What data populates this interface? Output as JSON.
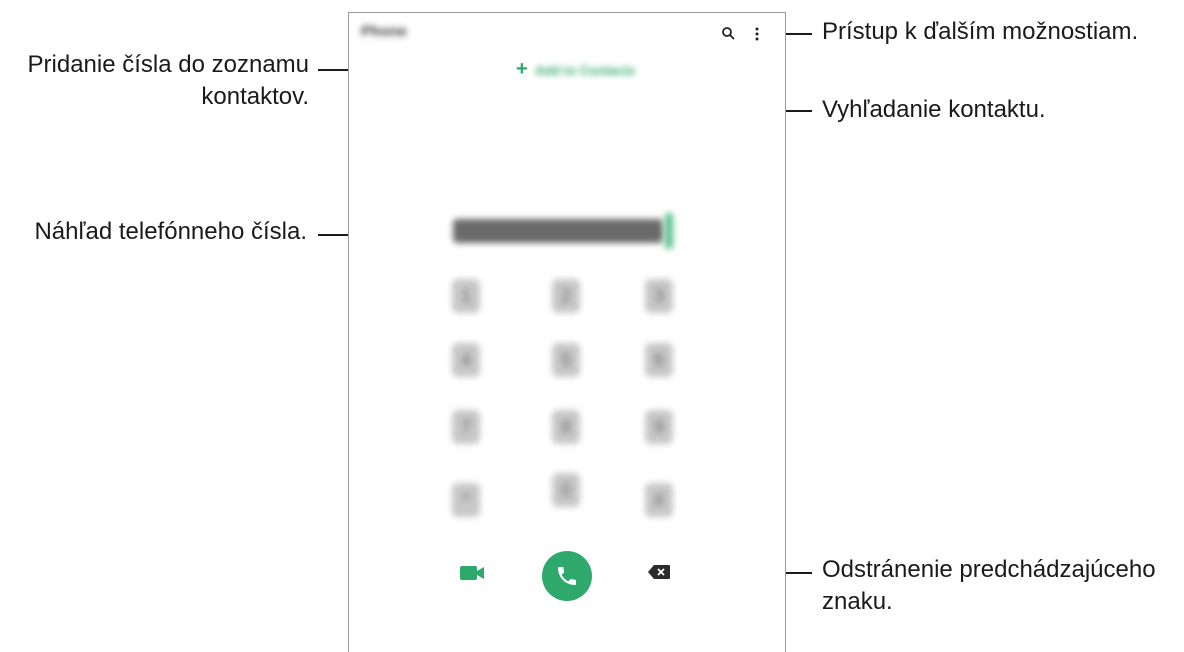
{
  "phone": {
    "app_title": "Phone",
    "add_to_contacts_label": "Add to Contacts",
    "add_plus": "+",
    "keypad": [
      "1",
      "2",
      "3",
      "4",
      "5",
      "6",
      "7",
      "8",
      "9",
      "*",
      "0",
      "#"
    ]
  },
  "callouts": {
    "add_number": "Pridanie čísla do zoznamu kontaktov.",
    "add_number_line1": "Pridanie čísla do zoznamu",
    "add_number_line2": "kontaktov.",
    "preview": "Náhľad telefónneho čísla.",
    "more_options": "Prístup k ďalším možnostiam.",
    "search_contact": "Vyhľadanie kontaktu.",
    "delete_char_line1": "Odstránenie predchádzajúceho",
    "delete_char_line2": "znaku."
  },
  "colors": {
    "accent": "#2fa86b",
    "text": "#1a1a1a",
    "frame": "#9a9a9a"
  },
  "icons": {
    "search": "search-icon",
    "more": "more-options-icon",
    "video": "video-call-icon",
    "call": "phone-icon",
    "backspace": "backspace-icon"
  }
}
